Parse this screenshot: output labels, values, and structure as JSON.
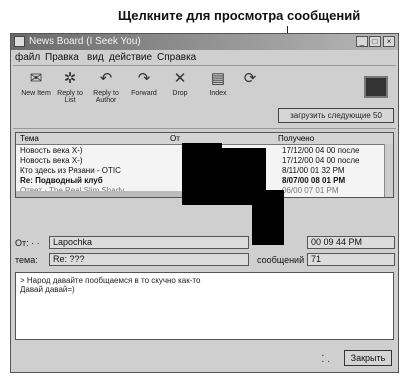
{
  "callout": {
    "text_bold": "Щелкните",
    "text_rest": " для просмотра сообщений"
  },
  "window": {
    "title": "News Board (I Seek You)",
    "menu": [
      "файл",
      "Правка",
      "вид",
      "действие",
      "Справка"
    ],
    "toolbar": [
      {
        "icon": "envelope-icon",
        "label": "New Item"
      },
      {
        "icon": "reply-list-icon",
        "label": "Reply to List"
      },
      {
        "icon": "reply-author-icon",
        "label": "Reply to Author"
      },
      {
        "icon": "forward-icon",
        "label": "Forward"
      },
      {
        "icon": "delete-icon",
        "label": "Drop"
      },
      {
        "icon": "index-icon",
        "label": "Index"
      },
      {
        "icon": "refresh-icon",
        "label": ""
      }
    ],
    "load_button": "загрузить следующие 50",
    "list": {
      "columns": [
        "Тема",
        "От",
        "Получено"
      ],
      "rows": [
        {
          "subject": "Новость века X-)",
          "received": "17/12/00 04 00 после"
        },
        {
          "subject": "Новость века X-)",
          "received": "17/12/00 04 00 после"
        },
        {
          "subject": "Кто здесь из Рязани - OTIC",
          "received": "8/11/00 01 32 PM"
        },
        {
          "subject": "Re: Подводный клуб",
          "received": "8/07/00 08 01 PM"
        },
        {
          "subject": "Ответ · The Real Slim Shady",
          "received": "06/00 07 01 PM"
        }
      ]
    },
    "from_label": "От: · ·",
    "from_value": "Lapochka",
    "date_value": "00 09 44 PM",
    "subject_label": "тема:",
    "subject_value": "Re: ???",
    "messages_label": "сообщений",
    "messages_value": "71",
    "body": [
      "> Народ давайте пообщаемся  в то скучно как-то",
      "Давай давай=)"
    ],
    "close_button": "Закрыть"
  }
}
